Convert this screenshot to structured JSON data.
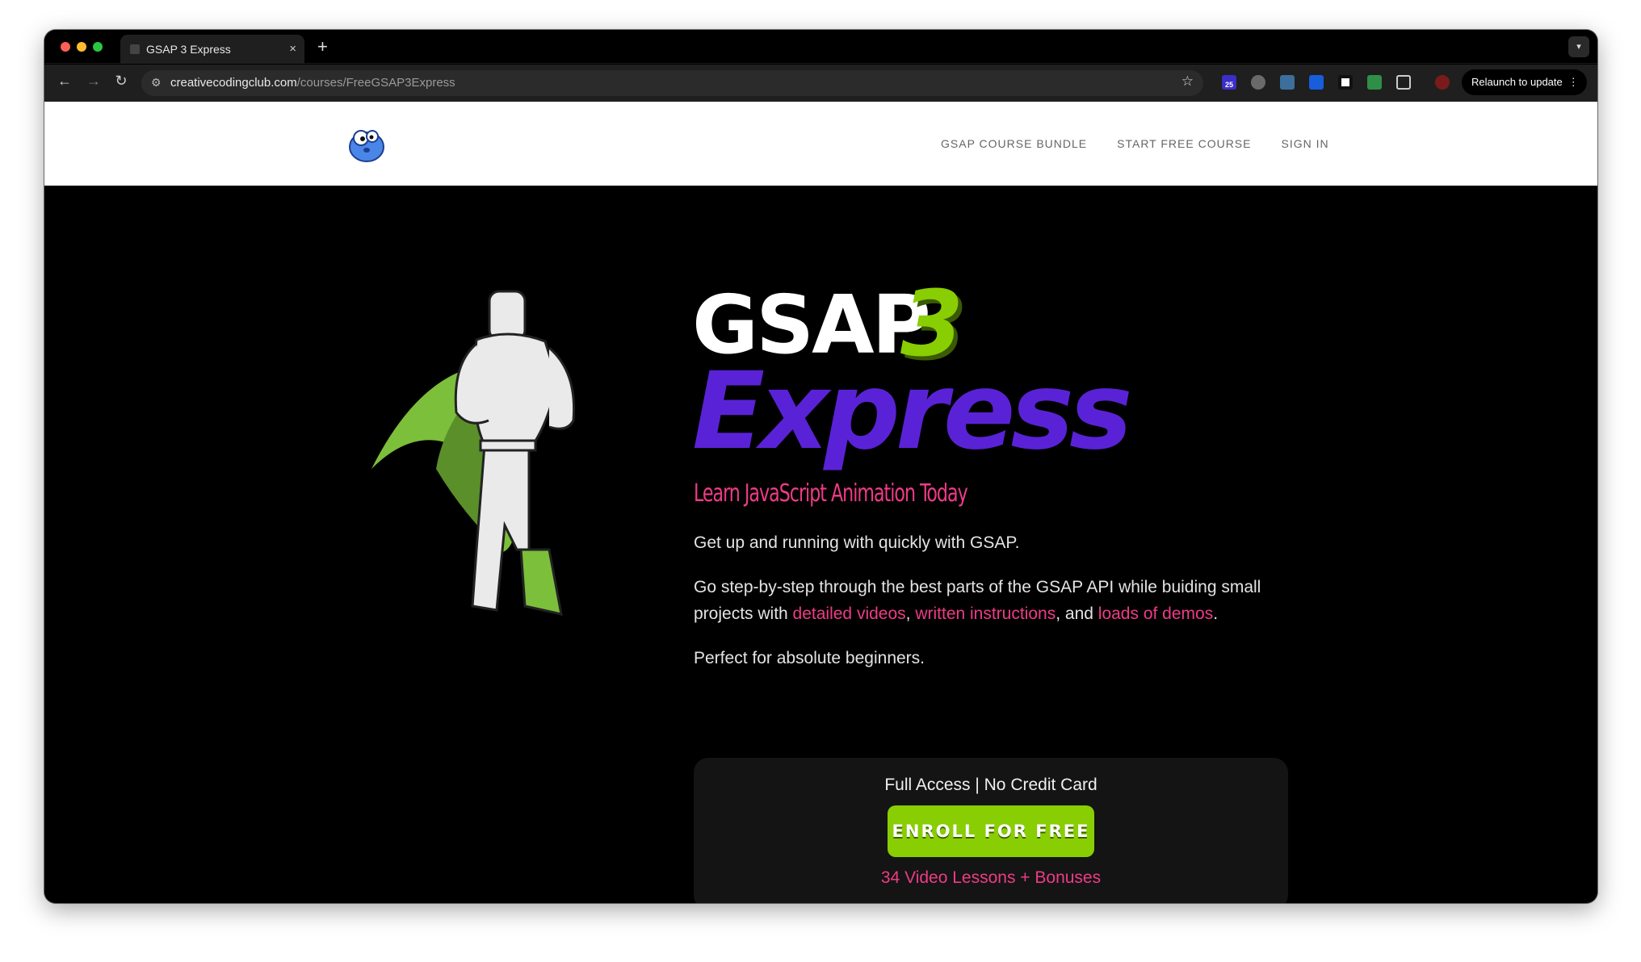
{
  "browser": {
    "tab_title": "GSAP 3 Express",
    "tab_close": "×",
    "new_tab": "+",
    "url_host": "creativecodingclub.com",
    "url_path": "/courses/FreeGSAP3Express",
    "extension_badge": "25",
    "relaunch_label": "Relaunch to update",
    "relaunch_menu": "⋮"
  },
  "site_nav": {
    "links": [
      "GSAP COURSE BUNDLE",
      "START FREE COURSE",
      "SIGN IN"
    ]
  },
  "hero": {
    "title_gsap": "GSAP",
    "title_three": "3",
    "title_express": "Express",
    "subtitle": "Learn JavaScript Animation Today",
    "para1": "Get up and running with quickly with GSAP.",
    "para2_start": "Go step-by-step through the best parts of the GSAP API while buiding small projects with ",
    "para2_link1": "detailed videos",
    "para2_sep1": ", ",
    "para2_link2": "written instructions",
    "para2_sep2": ", and ",
    "para2_link3": "loads of demos",
    "para2_end": ".",
    "para3": "Perfect for absolute beginners."
  },
  "cta": {
    "top_text": "Full Access | No Credit Card",
    "button_label": "ENROLL FOR FREE",
    "bottom_text": "34 Video Lessons + Bonuses"
  },
  "colors": {
    "accent_green": "#88ce02",
    "accent_purple": "#5a22d6",
    "accent_pink": "#ee3b86"
  }
}
